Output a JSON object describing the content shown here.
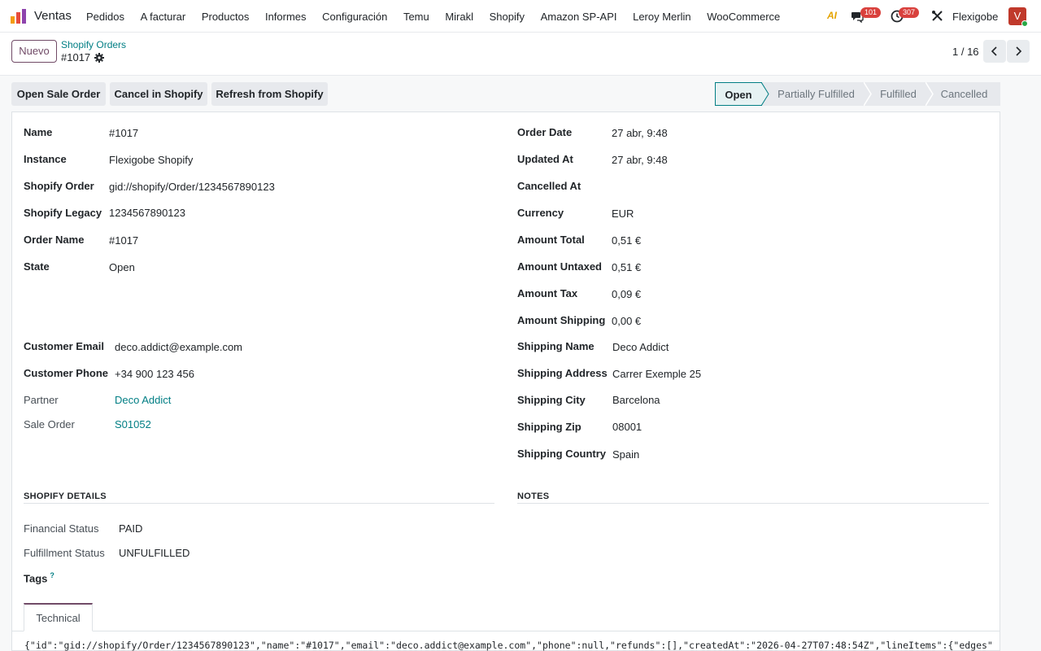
{
  "navbar": {
    "brand": "Ventas",
    "menu": [
      "Pedidos",
      "A facturar",
      "Productos",
      "Informes",
      "Configuración",
      "Temu",
      "Mirakl",
      "Shopify",
      "Amazon SP-API",
      "Leroy Merlin",
      "WooCommerce"
    ],
    "ai_label": "AI",
    "messages_badge": "101",
    "activities_badge": "307",
    "company": "Flexigobe",
    "avatar_letter": "V"
  },
  "control_panel": {
    "new_button": "Nuevo",
    "breadcrumb": "Shopify Orders",
    "record_title": "#1017",
    "pager": "1 / 16"
  },
  "actions": {
    "open_sale_order": "Open Sale Order",
    "cancel_in_shopify": "Cancel in Shopify",
    "refresh_from_shopify": "Refresh from Shopify"
  },
  "statusbar": {
    "stages": [
      "Open",
      "Partially Fulfilled",
      "Fulfilled",
      "Cancelled"
    ],
    "active": "Open"
  },
  "left_group": [
    {
      "label": "Name",
      "value": "#1017"
    },
    {
      "label": "Instance",
      "value": "Flexigobe Shopify"
    },
    {
      "label": "Shopify Order",
      "value": "gid://shopify/Order/1234567890123"
    },
    {
      "label": "Shopify Legacy",
      "value": "1234567890123"
    },
    {
      "label": "Order Name",
      "value": "#1017"
    },
    {
      "label": "State",
      "value": "Open"
    }
  ],
  "customer_group": [
    {
      "label": "Customer Email",
      "value": "deco.addict@example.com"
    },
    {
      "label": "Customer Phone",
      "value": "+34 900 123 456"
    },
    {
      "label": "Partner",
      "value": "Deco Addict"
    },
    {
      "label": "Sale Order",
      "value": "S01052"
    }
  ],
  "right_group": [
    {
      "label": "Order Date",
      "value": "27 abr, 9:48"
    },
    {
      "label": "Updated At",
      "value": "27 abr, 9:48"
    },
    {
      "label": "Cancelled At",
      "value": ""
    },
    {
      "label": "Currency",
      "value": "EUR"
    },
    {
      "label": "Amount Total",
      "value": "0,51 €"
    },
    {
      "label": "Amount Untaxed",
      "value": "0,51 €"
    },
    {
      "label": "Amount Tax",
      "value": "0,09 €"
    },
    {
      "label": "Amount Shipping",
      "value": "0,00 €"
    }
  ],
  "shipping_group": [
    {
      "label": "Shipping Name",
      "value": "Deco Addict"
    },
    {
      "label": "Shipping Address",
      "value": "Carrer Exemple 25"
    },
    {
      "label": "Shipping City",
      "value": "Barcelona"
    },
    {
      "label": "Shipping Zip",
      "value": "08001"
    },
    {
      "label": "Shipping Country",
      "value": "Spain"
    }
  ],
  "shopify_details": {
    "title": "SHOPIFY DETAILS",
    "financial_status_label": "Financial Status",
    "financial_status": "PAID",
    "fulfillment_status_label": "Fulfillment Status",
    "fulfillment_status": "UNFULFILLED",
    "tags_label": "Tags",
    "tags_help": "?"
  },
  "notes": {
    "title": "NOTES"
  },
  "tabs": {
    "technical": "Technical"
  },
  "raw_json": "{\"id\":\"gid://shopify/Order/1234567890123\",\"name\":\"#1017\",\"email\":\"deco.addict@example.com\",\"phone\":null,\"refunds\":[],\"createdAt\":\"2026-04-27T07:48:54Z\",\"lineItems\":{\"edges\":[{\"node\":"
}
